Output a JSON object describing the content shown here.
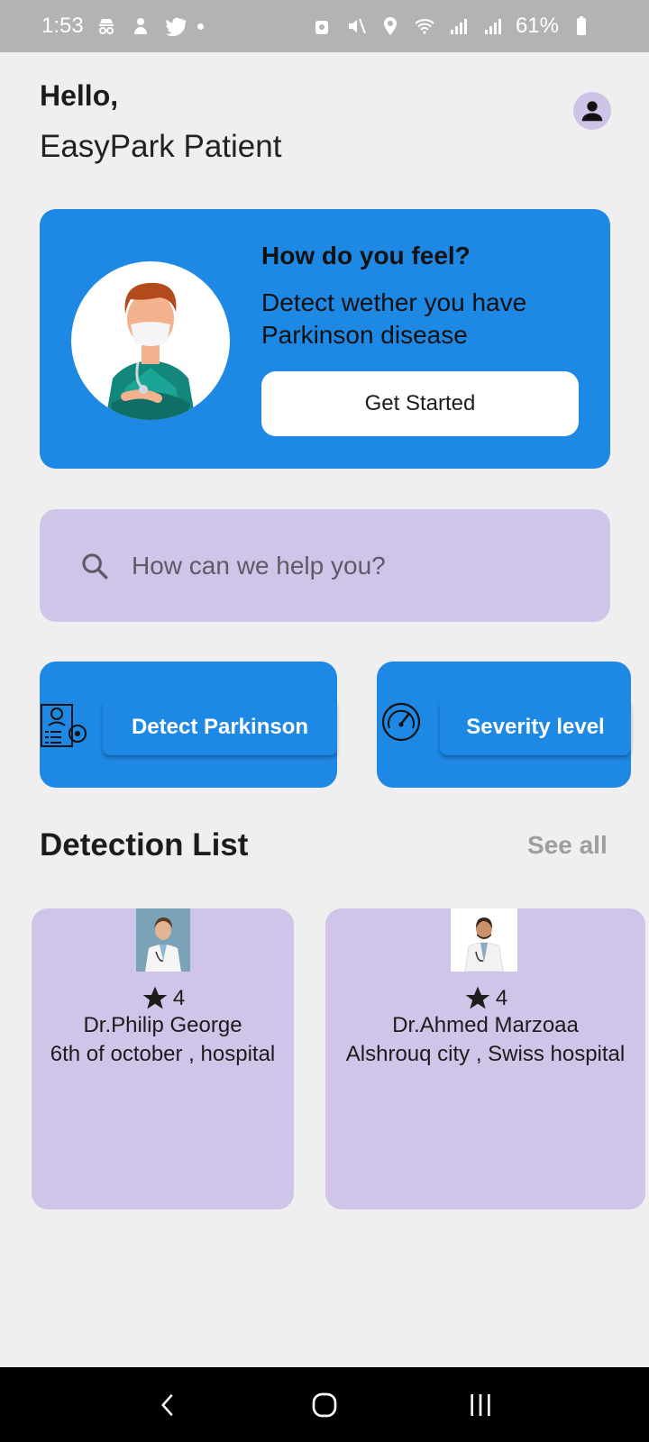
{
  "status_bar": {
    "time": "1:53",
    "battery": "61%"
  },
  "header": {
    "greeting": "Hello,",
    "user_name": "EasyPark Patient"
  },
  "hero": {
    "title": "How do you feel?",
    "description": "Detect wether you have Parkinson disease",
    "button_label": "Get Started"
  },
  "search": {
    "placeholder": "How can we help you?"
  },
  "actions": [
    {
      "label": "Detect Parkinson",
      "icon": "patient-report-icon"
    },
    {
      "label": "Severity level",
      "icon": "gauge-icon"
    }
  ],
  "detection_list": {
    "title": "Detection List",
    "see_all": "See all",
    "doctors": [
      {
        "rating": "4",
        "name": "Dr.Philip George",
        "place": "6th of october , hospital"
      },
      {
        "rating": "4",
        "name": "Dr.Ahmed Marzoaa",
        "place": "Alshrouq city , Swiss hospital"
      }
    ]
  },
  "colors": {
    "primary": "#1e88e5",
    "lavender": "#d1c4e9",
    "background": "#efefef"
  }
}
